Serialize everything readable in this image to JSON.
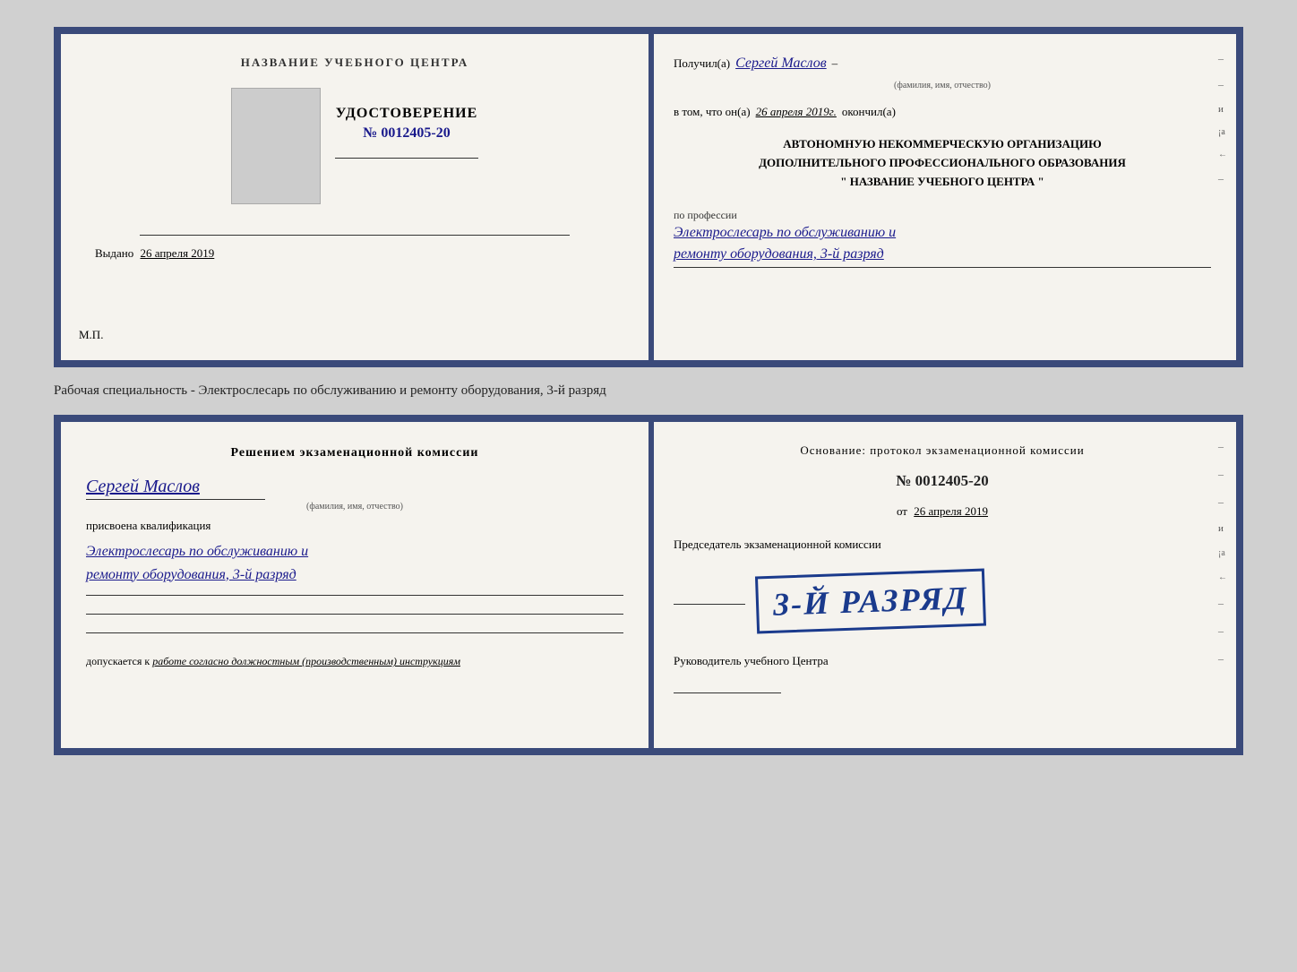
{
  "top_cert": {
    "left": {
      "org_name": "НАЗВАНИЕ УЧЕБНОГО ЦЕНТРА",
      "cert_title": "УДОСТОВЕРЕНИЕ",
      "cert_number": "№ 0012405-20",
      "issued_label": "Выдано",
      "issued_date": "26 апреля 2019",
      "mp_label": "М.П."
    },
    "right": {
      "received_prefix": "Получил(а)",
      "recipient_name": "Сергей Маслов",
      "fio_sublabel": "(фамилия, имя, отчество)",
      "in_that_prefix": "в том, что он(а)",
      "in_that_date": "26 апреля 2019г.",
      "finished_label": "окончил(а)",
      "org_line1": "АВТОНОМНУЮ НЕКОММЕРЧЕСКУЮ ОРГАНИЗАЦИЮ",
      "org_line2": "ДОПОЛНИТЕЛЬНОГО ПРОФЕССИОНАЛЬНОГО ОБРАЗОВАНИЯ",
      "org_line3": "\"  НАЗВАНИЕ УЧЕБНОГО ЦЕНТРА  \"",
      "profession_label": "по профессии",
      "profession_value_line1": "Электрослесарь по обслуживанию и",
      "profession_value_line2": "ремонту оборудования, 3-й разряд"
    }
  },
  "middle_text": "Рабочая специальность - Электрослесарь по обслуживанию и ремонту оборудования, 3-й разряд",
  "bottom_cert": {
    "left": {
      "decision_title": "Решением экзаменационной комиссии",
      "fio_name": "Сергей Маслов",
      "fio_sublabel": "(фамилия, имя, отчество)",
      "qualification_label": "присвоена квалификация",
      "qualification_line1": "Электрослесарь по обслуживанию и",
      "qualification_line2": "ремонту оборудования, 3-й разряд",
      "allowed_prefix": "допускается к",
      "allowed_italic": "работе согласно должностным (производственным) инструкциям"
    },
    "right": {
      "basis_title": "Основание: протокол экзаменационной комиссии",
      "protocol_number": "№  0012405-20",
      "protocol_date_prefix": "от",
      "protocol_date": "26 апреля 2019",
      "chairman_label": "Председатель экзаменационной комиссии",
      "stamp_text": "3-й разряд",
      "director_label": "Руководитель учебного Центра"
    }
  },
  "side_chars": {
    "top_right": [
      "–",
      "–",
      "и",
      "¡а",
      "←",
      "–"
    ]
  }
}
